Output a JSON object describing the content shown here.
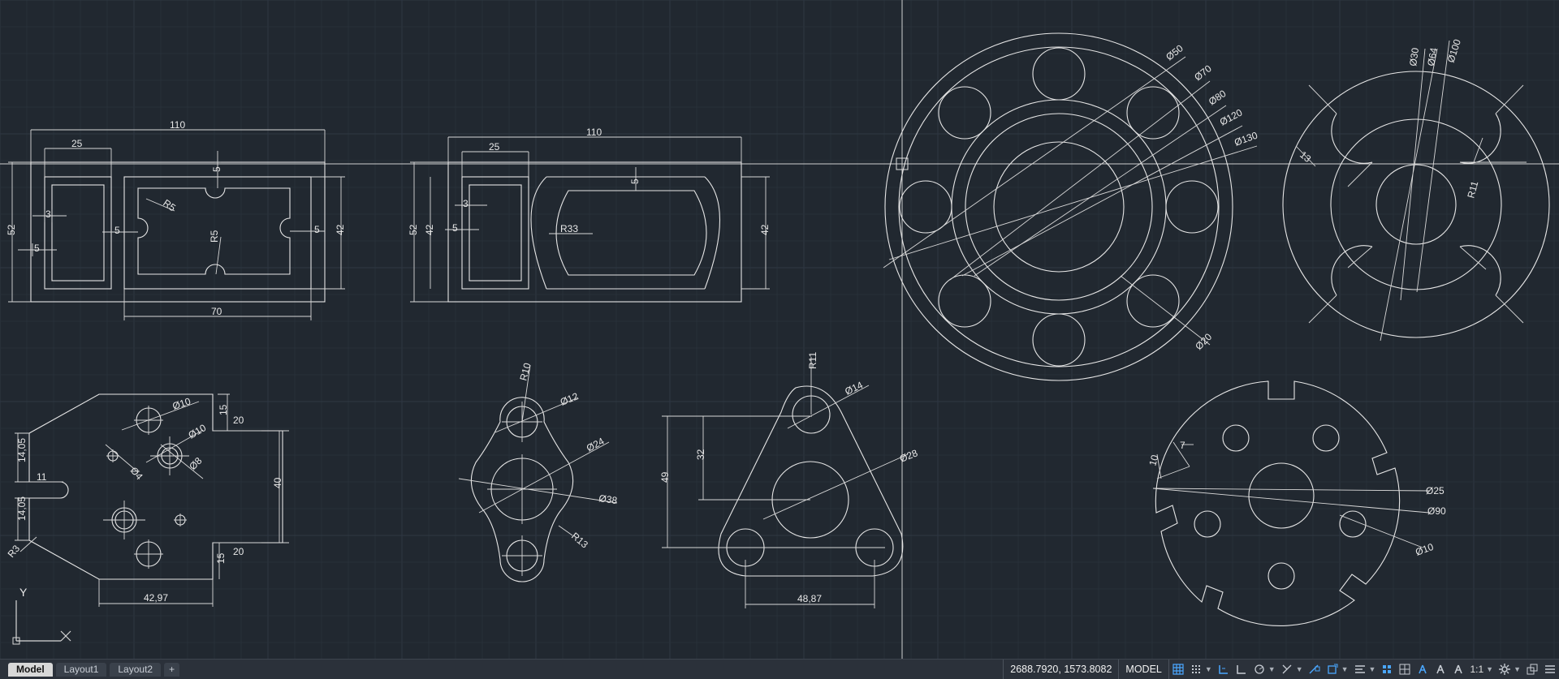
{
  "drawing": {
    "dims": {
      "d110a": "110",
      "d25a": "25",
      "d52a": "52",
      "d5a": "5",
      "d3a": "3",
      "d5b": "5",
      "dR5a": "R5",
      "d5c": "5",
      "dR5b": "R5",
      "d5d": "5",
      "d42a": "42",
      "d70": "70",
      "d110b": "110",
      "d25b": "25",
      "d52b": "52",
      "d42b": "42",
      "d3b": "3",
      "d5e": "5",
      "dR33": "R33",
      "d5f": "5",
      "d42c": "42",
      "dO50": "Ø50",
      "dO70": "Ø70",
      "dO80": "Ø80",
      "dO120": "Ø120",
      "dO130": "Ø130",
      "dO20": "Ø20",
      "dO30": "Ø30",
      "dO64": "Ø64",
      "dO100": "Ø100",
      "d13": "13",
      "dR11a": "R11",
      "dO10a": "Ø10",
      "d15a": "15",
      "d20a": "20",
      "dO10b": "Ø10",
      "dO4": "Ø4",
      "dO8": "Ø8",
      "d14_05a": "14,05",
      "d11": "11",
      "d14_05b": "14,05",
      "d40": "40",
      "dR3": "R3",
      "d20b": "20",
      "d15b": "15",
      "d42_97": "42,97",
      "dR10": "R10",
      "dO12": "Ø12",
      "dO24": "Ø24",
      "dO38": "Ø38",
      "dR13": "R13",
      "dR11b": "R11",
      "dO14": "Ø14",
      "d32": "32",
      "d49": "49",
      "dO28": "Ø28",
      "d48_87": "48,87",
      "d10": "10",
      "d7": "7",
      "dO25": "Ø25",
      "dO90": "Ø90",
      "dO10c": "Ø10"
    },
    "ucs": {
      "y_label": "Y"
    }
  },
  "statusbar": {
    "tabs": [
      {
        "label": "Model",
        "active": true
      },
      {
        "label": "Layout1",
        "active": false
      },
      {
        "label": "Layout2",
        "active": false
      }
    ],
    "add_tab_label": "+",
    "coordinates": "2688.7920, 1573.8082",
    "mode": "MODEL",
    "scale": "1:1",
    "tools": [
      "grid-icon",
      "snap-icon",
      "infer-icon",
      "ortho-icon",
      "polar-icon",
      "isodraft-icon",
      "osnap-icon",
      "lineweight-icon",
      "transparency-icon",
      "selection-cycling-icon",
      "annotation-visibility-icon",
      "autoscale-icon",
      "annotation-scale-icon",
      "workspace-gear-icon",
      "isolate-icon",
      "customize-menu-icon"
    ],
    "accent_color": "#4aa7ff"
  }
}
